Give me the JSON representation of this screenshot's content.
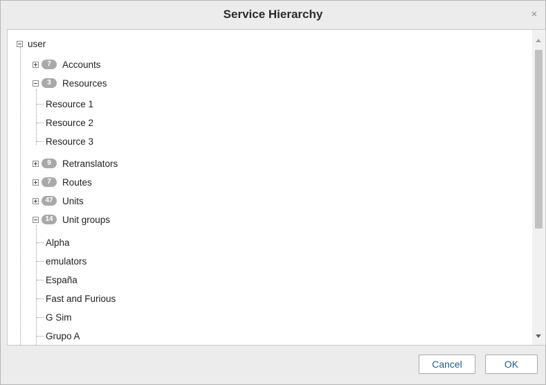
{
  "dialog": {
    "title": "Service Hierarchy",
    "close_glyph": "×",
    "cancel_label": "Cancel",
    "ok_label": "OK"
  },
  "tree": {
    "root": "user",
    "groups": {
      "accounts": {
        "label": "Accounts",
        "count": "7",
        "expanded": false
      },
      "resources": {
        "label": "Resources",
        "count": "3",
        "expanded": true,
        "children": [
          "Resource 1",
          "Resource 2",
          "Resource 3"
        ]
      },
      "retranslators": {
        "label": "Retranslators",
        "count": "9",
        "expanded": false
      },
      "routes": {
        "label": "Routes",
        "count": "7",
        "expanded": false
      },
      "units": {
        "label": "Units",
        "count": "47",
        "expanded": false
      },
      "unit_groups": {
        "label": "Unit groups",
        "count": "14",
        "expanded": true,
        "children": [
          "Alpha",
          "emulators",
          "España",
          "Fast and Furious",
          "G Sim",
          "Grupo A"
        ]
      }
    }
  },
  "colors": {
    "badge": "#a9a9a9",
    "button_text": "#1f5b8f",
    "dialog_bg": "#ececec"
  }
}
